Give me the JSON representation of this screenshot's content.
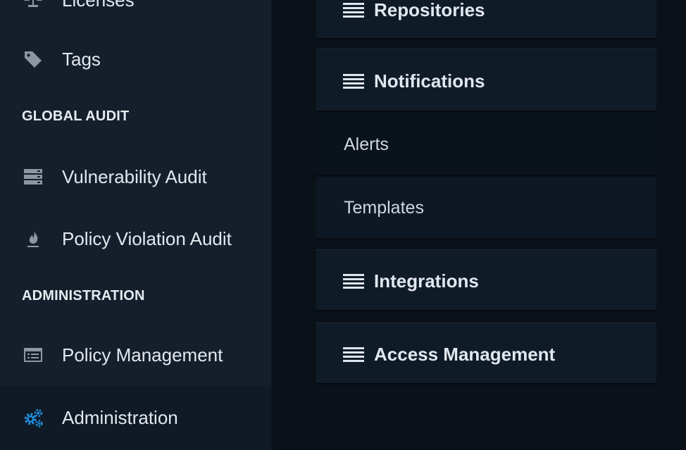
{
  "sidebar": {
    "items": {
      "licenses": {
        "label": "Licenses",
        "icon": "scale-icon"
      },
      "tags": {
        "label": "Tags",
        "icon": "tag-icon"
      },
      "vulnerability_audit": {
        "label": "Vulnerability Audit",
        "icon": "server-icon"
      },
      "policy_violation_audit": {
        "label": "Policy Violation Audit",
        "icon": "fire-icon"
      },
      "policy_management": {
        "label": "Policy Management",
        "icon": "list-alt-icon"
      },
      "administration": {
        "label": "Administration",
        "icon": "cogs-icon"
      }
    },
    "sections": {
      "global_audit": "GLOBAL AUDIT",
      "administration": "ADMINISTRATION"
    }
  },
  "admin_menu": {
    "repositories": "Repositories",
    "notifications": "Notifications",
    "notifications_children": {
      "alerts": "Alerts",
      "templates": "Templates"
    },
    "integrations": "Integrations",
    "access_management": "Access Management"
  },
  "colors": {
    "sidebar_bg": "#151f2c",
    "content_bg": "#0b1119",
    "panel_bg": "#101b28",
    "accent_icon": "#1e8fe0"
  }
}
